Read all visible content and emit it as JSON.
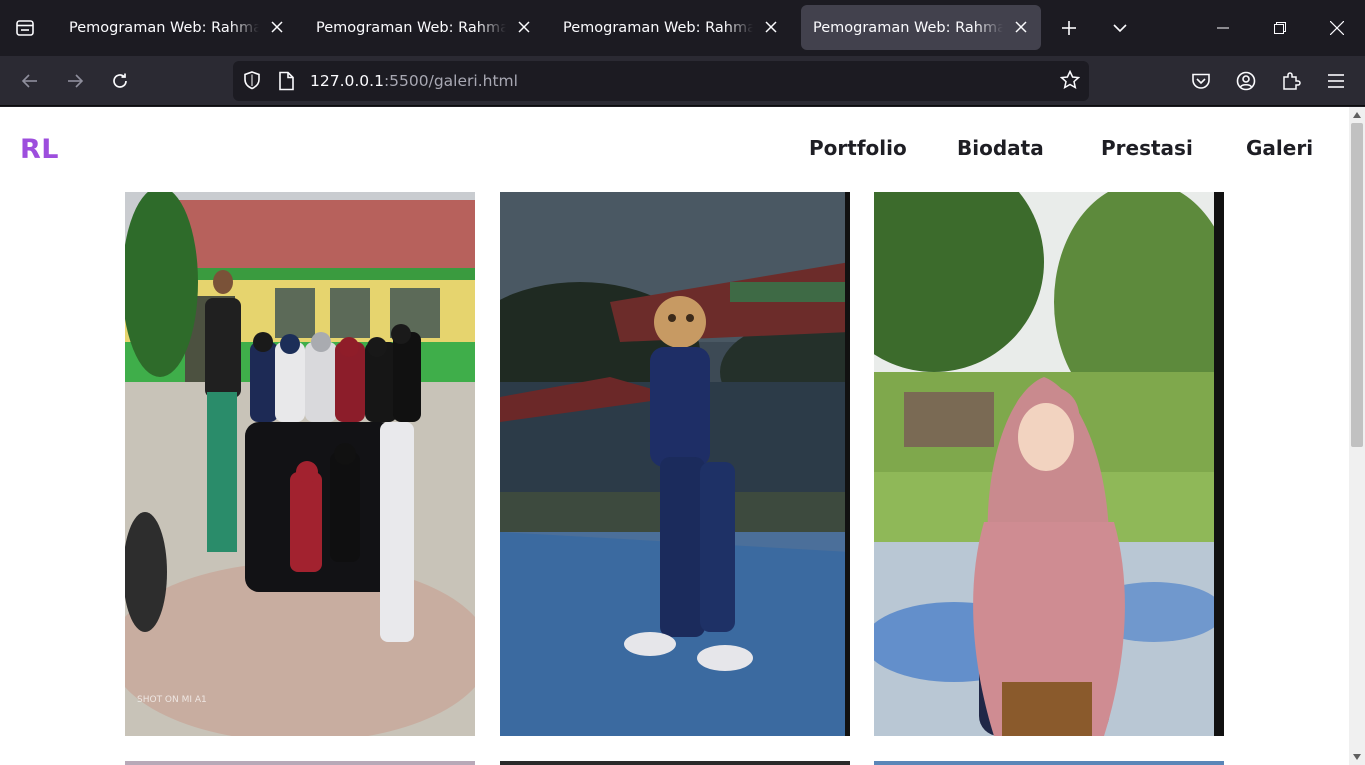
{
  "browser": {
    "tabs": [
      {
        "title": "Pemograman Web: Rahma Lak",
        "active": false
      },
      {
        "title": "Pemograman Web: Rahma Lak",
        "active": false
      },
      {
        "title": "Pemograman Web: Rahma Lak",
        "active": false
      },
      {
        "title": "Pemograman Web: Rahma Lak",
        "active": true
      }
    ],
    "url": {
      "host": "127.0.0.1",
      "rest": ":5500/galeri.html"
    }
  },
  "page": {
    "logo": "RL",
    "nav": [
      "Portfolio",
      "Biodata",
      "Prestasi",
      "Galeri"
    ],
    "gallery": [
      {
        "alt": "group-photo"
      },
      {
        "alt": "person-walking"
      },
      {
        "alt": "smiling-person-in-hijab"
      }
    ]
  },
  "colors": {
    "accent": "#9d4edd",
    "tab_bar": "#1c1b22",
    "toolbar": "#2b2a33",
    "active_tab": "#42414d"
  }
}
